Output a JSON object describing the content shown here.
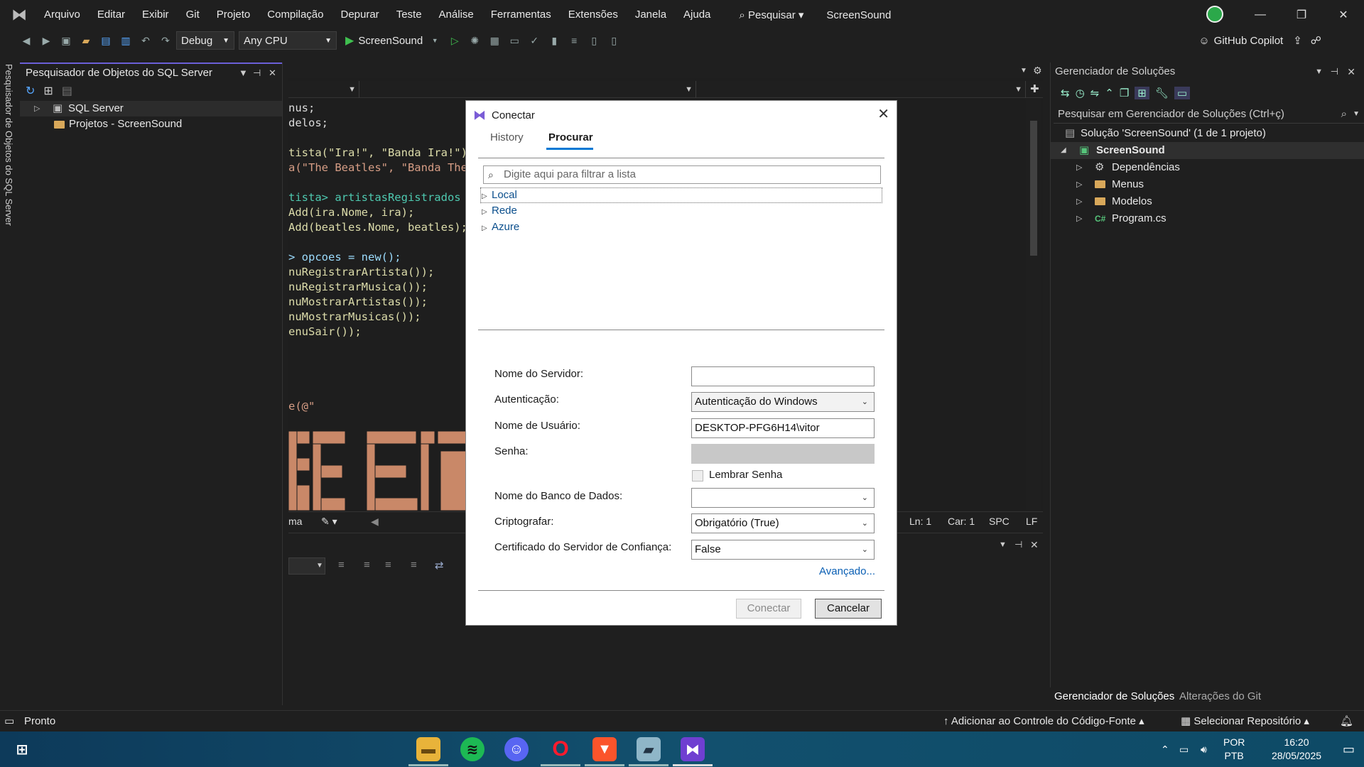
{
  "menubar": {
    "items": [
      "Arquivo",
      "Editar",
      "Exibir",
      "Git",
      "Projeto",
      "Compilação",
      "Depurar",
      "Teste",
      "Análise",
      "Ferramentas",
      "Extensões",
      "Janela",
      "Ajuda"
    ],
    "search": "Pesquisar",
    "solution_name": "ScreenSound"
  },
  "toolbar": {
    "config": "Debug",
    "platform": "Any CPU",
    "run_target": "ScreenSound",
    "copilot": "GitHub Copilot"
  },
  "sql_explorer": {
    "title": "Pesquisador de Objetos do SQL Server",
    "vertical_tab": "Pesquisador de Objetos do SQL Server",
    "nodes": [
      "SQL Server",
      "Projetos - ScreenSound"
    ]
  },
  "editor": {
    "lines": [
      "nus;",
      "delos;",
      "",
      "tista(\"Ira!\", \"Banda Ira!\")",
      "a(\"The Beatles\", \"Banda The",
      "",
      "tista> artistasRegistrados",
      "Add(ira.Nome, ira);",
      "Add(beatles.Nome, beatles);",
      "",
      "> opcoes = new();",
      "nuRegistrarArtista());",
      "nuRegistrarMusica());",
      "nuMostrarArtistas());",
      "nuMostrarMusicas());",
      "enuSair());",
      "",
      "",
      "",
      "",
      "e(@\""
    ],
    "status": {
      "left": "ma",
      "ln": "Ln: 1",
      "car": "Car: 1",
      "spc": "SPC",
      "lf": "LF"
    }
  },
  "solution_explorer": {
    "title": "Gerenciador de Soluções",
    "search_placeholder": "Pesquisar em Gerenciador de Soluções (Ctrl+ç)",
    "solution": "Solução 'ScreenSound' (1 de 1 projeto)",
    "project": "ScreenSound",
    "items": [
      "Dependências",
      "Menus",
      "Modelos",
      "Program.cs"
    ],
    "tabs": [
      "Gerenciador de Soluções",
      "Alterações do Git"
    ]
  },
  "statusbar": {
    "ready": "Pronto",
    "source_control": "Adicionar ao Controle do Código-Fonte",
    "repo": "Selecionar Repositório"
  },
  "taskbar": {
    "lang1": "POR",
    "lang2": "PTB",
    "time": "16:20",
    "date": "28/05/2025"
  },
  "dialog": {
    "title": "Conectar",
    "tabs": [
      "History",
      "Procurar"
    ],
    "filter_placeholder": "Digite aqui para filtrar a lista",
    "tree": [
      "Local",
      "Rede",
      "Azure"
    ],
    "fields": {
      "server_label": "Nome do Servidor:",
      "server_value": "",
      "auth_label": "Autenticação:",
      "auth_value": "Autenticação do Windows",
      "user_label": "Nome de Usuário:",
      "user_value": "DESKTOP-PFG6H14\\vitor",
      "pass_label": "Senha:",
      "remember_label": "Lembrar Senha",
      "db_label": "Nome do Banco de Dados:",
      "db_value": "",
      "encrypt_label": "Criptografar:",
      "encrypt_value": "Obrigatório (True)",
      "cert_label": "Certificado do Servidor de Confiança:",
      "cert_value": "False"
    },
    "advanced": "Avançado...",
    "connect_button": "Conectar",
    "cancel_button": "Cancelar"
  },
  "colors": {
    "accent": "#6b5fd8",
    "link": "#0a4e8c",
    "primary": "#0078d4"
  }
}
